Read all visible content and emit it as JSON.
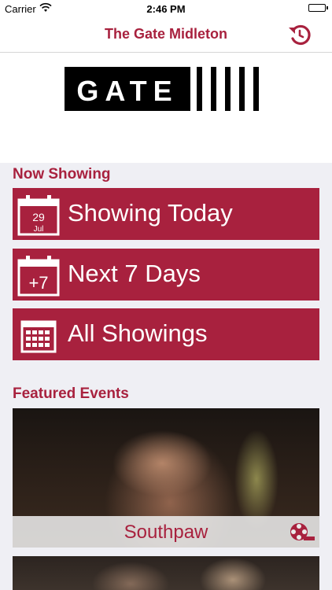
{
  "status": {
    "carrier": "Carrier",
    "time": "2:46 PM"
  },
  "nav": {
    "title": "The Gate Midleton",
    "refresh_icon": "refresh-icon"
  },
  "logo": {
    "text": "GATE"
  },
  "now_showing": {
    "title": "Now Showing",
    "buttons": [
      {
        "label": "Showing Today",
        "icon": "calendar-today-icon",
        "icon_day": "29",
        "icon_month": "Jul"
      },
      {
        "label": "Next 7 Days",
        "icon": "calendar-plus7-icon",
        "icon_text": "+7"
      },
      {
        "label": "All Showings",
        "icon": "calendar-grid-icon"
      }
    ]
  },
  "featured": {
    "title": "Featured Events",
    "events": [
      {
        "title": "Southpaw",
        "icon": "film-reel-icon"
      }
    ]
  },
  "colors": {
    "accent": "#a8213e",
    "background": "#efeff4"
  }
}
